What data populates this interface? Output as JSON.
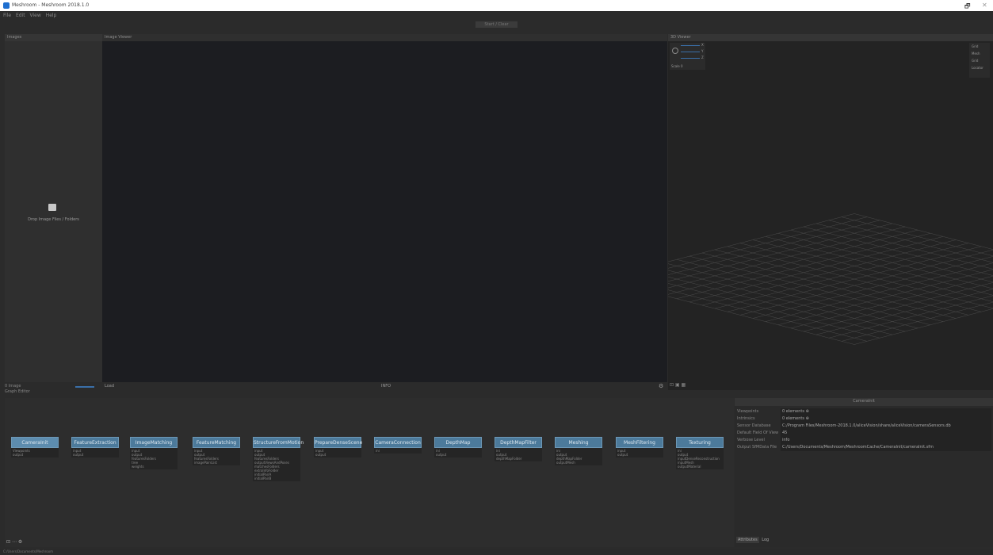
{
  "window": {
    "title": "Meshroom - Meshroom 2018.1.0",
    "btn_restore": "🗗",
    "btn_close": "✕"
  },
  "menu": [
    "File",
    "Edit",
    "View",
    "Help"
  ],
  "toolbar": {
    "compute_label": "Start / Clear"
  },
  "images_panel": {
    "header": "Images",
    "drop_text": "Drop Image Files / Folders",
    "count": "0 Image",
    "group_label": "Graph Editor"
  },
  "viewer": {
    "header": "Image Viewer",
    "footer_left": "Load",
    "footer_mid": "INFO"
  },
  "scene": {
    "header": "3D Viewer",
    "axes": [
      "X",
      "Y",
      "Z"
    ],
    "scale_label": "Scale 0",
    "layers": [
      "Grid",
      "Mesh",
      "Grid",
      "Locator"
    ],
    "footer_icons": [
      "⊡",
      "▣",
      "▦"
    ]
  },
  "graph": {
    "nodes": [
      {
        "name": "CameraInit",
        "rows": [
          "Viewpoints",
          "output"
        ]
      },
      {
        "name": "FeatureExtraction",
        "rows": [
          "input",
          "output"
        ]
      },
      {
        "name": "ImageMatching",
        "rows": [
          "input",
          "output",
          "featuresFolders",
          "tree",
          "weights"
        ]
      },
      {
        "name": "FeatureMatching",
        "rows": [
          "input",
          "output",
          "featuresFolders",
          "imagePairsList"
        ]
      },
      {
        "name": "StructureFromMotion",
        "rows": [
          "input",
          "output",
          "featuresFolders",
          "outputViewsAndPoses",
          "matchesFolders",
          "extraInfoFolder",
          "initialPairA",
          "initialPairB"
        ]
      },
      {
        "name": "PrepareDenseScene",
        "rows": [
          "input",
          "output"
        ]
      },
      {
        "name": "CameraConnection",
        "rows": [
          "ini"
        ]
      },
      {
        "name": "DepthMap",
        "rows": [
          "ini",
          "output"
        ]
      },
      {
        "name": "DepthMapFilter",
        "rows": [
          "ini",
          "output",
          "depthMapFolder"
        ]
      },
      {
        "name": "Meshing",
        "rows": [
          "ini",
          "output",
          "depthMapFolder",
          "outputMesh"
        ]
      },
      {
        "name": "MeshFiltering",
        "rows": [
          "input",
          "output"
        ]
      },
      {
        "name": "Texturing",
        "rows": [
          "ini",
          "output",
          "inputDenseReconstruction",
          "inputMesh",
          "outputMaterial"
        ]
      }
    ],
    "footer_icons": [
      "⊡",
      "⋯",
      "⚙"
    ]
  },
  "attributes": {
    "header": "CameraInit",
    "rows": [
      {
        "label": "Viewpoints",
        "value": "0 elements ⊕"
      },
      {
        "label": "Intrinsics",
        "value": "0 elements ⊕"
      },
      {
        "label": "Sensor Database",
        "value": "C:/Program Files/Meshroom-2018.1.0/aliceVision/share/aliceVision/cameraSensors.db"
      },
      {
        "label": "Default Field Of View",
        "value": "45"
      },
      {
        "label": "Verbose Level",
        "value": "info"
      },
      {
        "label": "Output SfMData File",
        "value": "C:/Users/Documents/Meshroom/MeshroomCache/CameraInit/cameraInit.sfm"
      }
    ],
    "tabs": [
      "Attributes",
      "Log"
    ]
  },
  "statusbar": "C:/Users/Documents/Meshroom"
}
